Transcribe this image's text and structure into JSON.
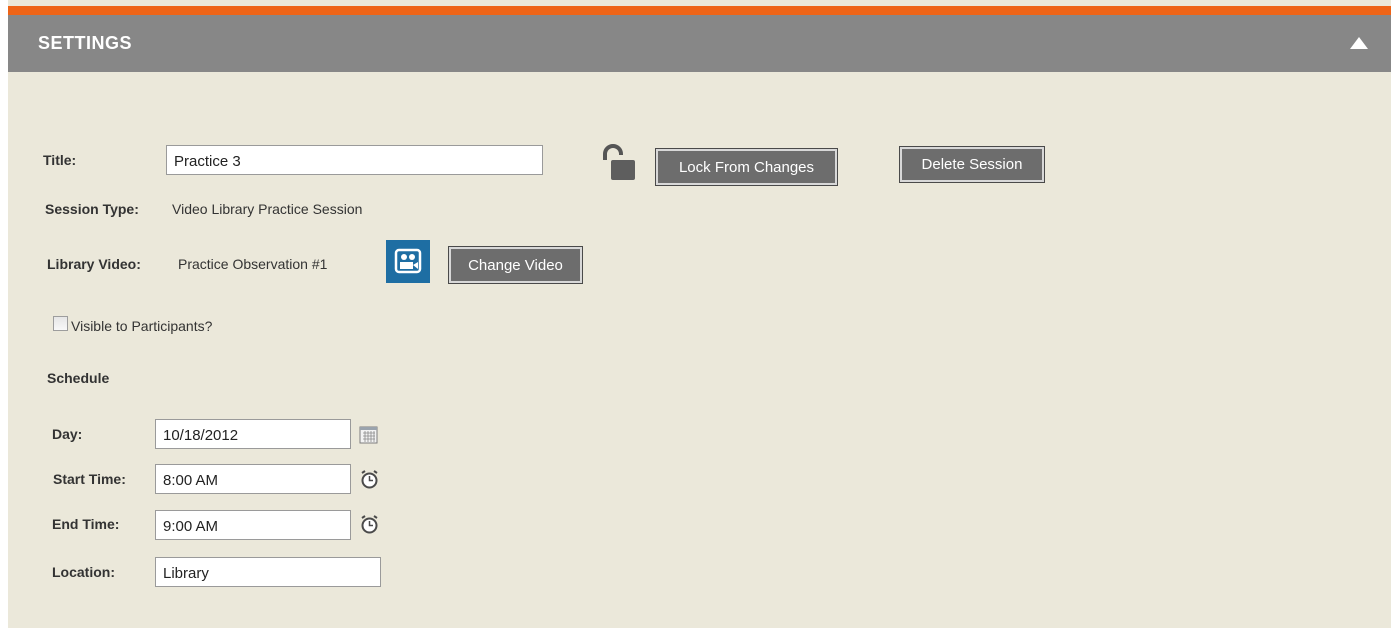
{
  "header": {
    "title": "SETTINGS",
    "collapse_icon": "triangle-up-icon"
  },
  "colors": {
    "accent": "#ee6417",
    "header_bg": "#878787",
    "panel_bg": "#ebe8da",
    "button_bg": "#6d6d6d",
    "video_icon_bg": "#1e6ea3"
  },
  "form": {
    "title_label": "Title:",
    "title_value": "Practice 3",
    "lock_icon": "unlocked-padlock-icon",
    "lock_button": "Lock From Changes",
    "delete_button": "Delete Session",
    "session_type_label": "Session Type:",
    "session_type_value": "Video Library Practice Session",
    "library_video_label": "Library Video:",
    "library_video_value": "Practice Observation #1",
    "video_icon": "video-camera-icon",
    "change_video_button": "Change Video",
    "visible_label": "Visible to Participants?",
    "visible_checked": false
  },
  "schedule": {
    "heading": "Schedule",
    "day_label": "Day:",
    "day_value": "10/18/2012",
    "calendar_icon": "calendar-icon",
    "start_label": "Start Time:",
    "start_value": "8:00 AM",
    "end_label": "End Time:",
    "end_value": "9:00 AM",
    "clock_icon": "alarm-clock-icon",
    "location_label": "Location:",
    "location_value": "Library"
  }
}
